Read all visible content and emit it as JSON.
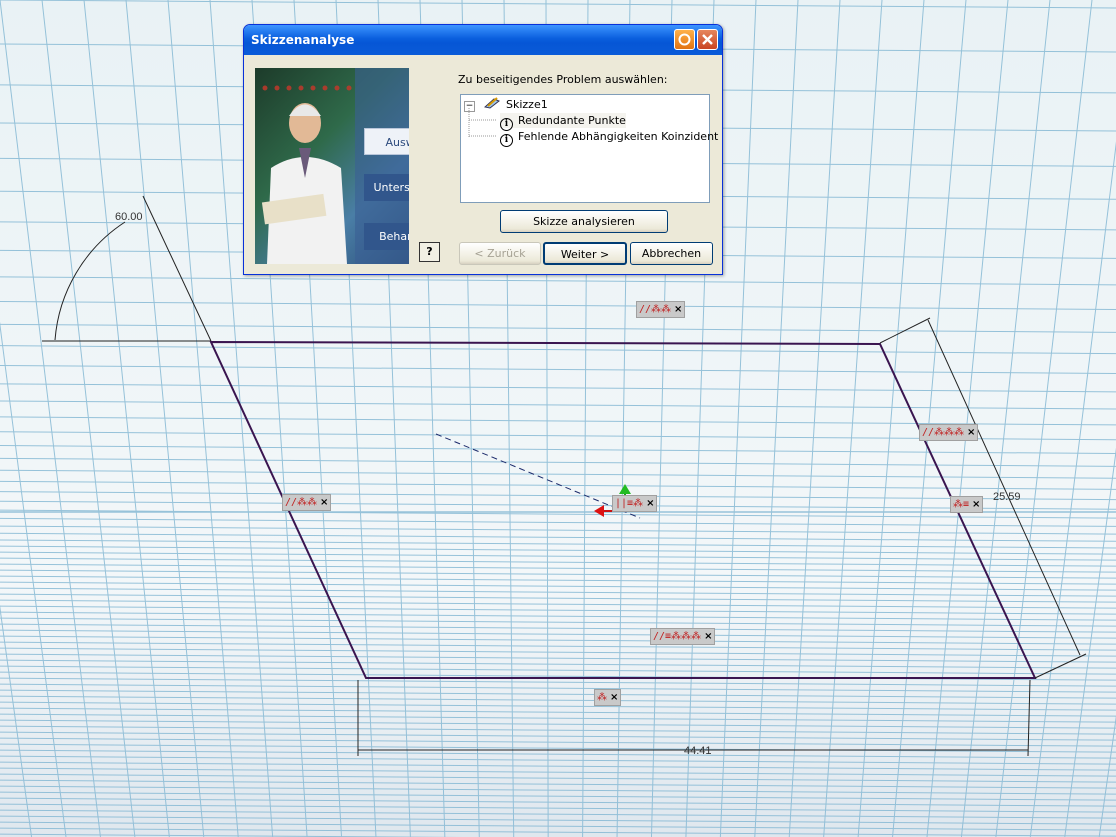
{
  "dialog": {
    "title": "Skizzenanalyse",
    "steps": [
      "Auswahl",
      "Untersuchen",
      "Behandeln"
    ],
    "help_button": "?",
    "prompt": "Zu beseitigendes Problem auswählen:",
    "tree": {
      "root_label": "Skizze1",
      "expander": "−",
      "items": [
        "Redundante Punkte",
        "Fehlende Abhängigkeiten Koinzident"
      ]
    },
    "analyze_button": "Skizze analysieren",
    "back_button": "< Zurück",
    "next_button": "Weiter >",
    "cancel_button": "Abbrechen"
  },
  "sketch": {
    "angle_dimension": "60.00",
    "side_dimension": "25.59",
    "bottom_dimension": "44.41",
    "constraint_glyphs": {
      "top": "//⁂⁂",
      "right_upper": "//⁂⁂⁂",
      "left": "//⁂⁂",
      "center": "||≡⁂",
      "right": "⁂≡",
      "lower": "//≡⁂⁂⁂",
      "bottom": "⁂"
    },
    "close_glyph": "×"
  },
  "colors": {
    "background_sky": "#e9f1f4",
    "grid": "#7fb5d2",
    "sketch_line": "#3a1550",
    "titlebar": "#0a5fde"
  }
}
